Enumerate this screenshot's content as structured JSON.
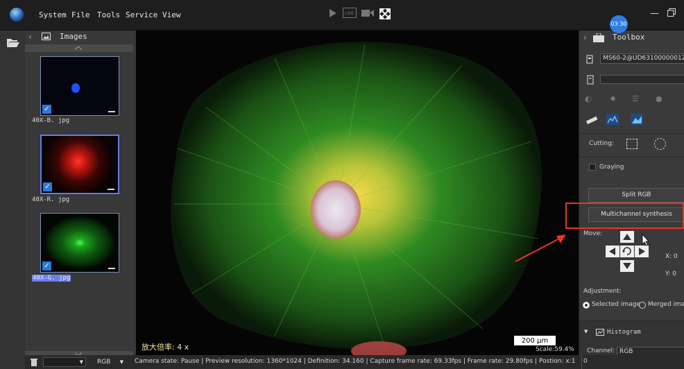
{
  "menu": [
    "System",
    "File",
    "Tools",
    "Service",
    "View"
  ],
  "timer": "03:30",
  "images_panel": {
    "title": "Images",
    "thumbnails": [
      {
        "label": "40X-B. jpg",
        "color": "#1f4fff",
        "selected": false,
        "highlighted": false
      },
      {
        "label": "40X-R. jpg",
        "color": "#ff2a1a",
        "selected": true,
        "highlighted": false
      },
      {
        "label": "40X-G. jpg",
        "color": "#27d02a",
        "selected": false,
        "highlighted": true
      }
    ]
  },
  "viewer": {
    "magnification": "放大倍率: 4 x",
    "scale_bar": "200 μm",
    "scale": "Scale:59.4%"
  },
  "status_bar": {
    "mode": "RGB",
    "text": "Camera state: Pause | Preview resolution: 1360*1024 | Definition: 34.160 | Capture frame rate: 69.33fps | Frame rate: 29.80fps | Postion: x:1"
  },
  "toolbox": {
    "title": "Toolbox",
    "camera": "MS60-2@UD63100000012",
    "cutting_label": "Cutting:",
    "graying_label": "Graying",
    "split_button": "Split RGB",
    "multichannel_button": "Multichannel synthesis",
    "move_label": "Move:",
    "x_label": "X: 0",
    "y_label": "Y: 0",
    "adjustment_label": "Adjustment:",
    "selected_image": "Selected image",
    "merged_image": "Merged imag",
    "histogram_label": "Histogram",
    "channel_label": "Channel:",
    "channel_value": "RGB",
    "histogram_start": "0"
  },
  "colors": {
    "highlight_box": "#e5352d",
    "accent": "#2d7ad6",
    "thumb_selection": "#6c7fe8"
  }
}
